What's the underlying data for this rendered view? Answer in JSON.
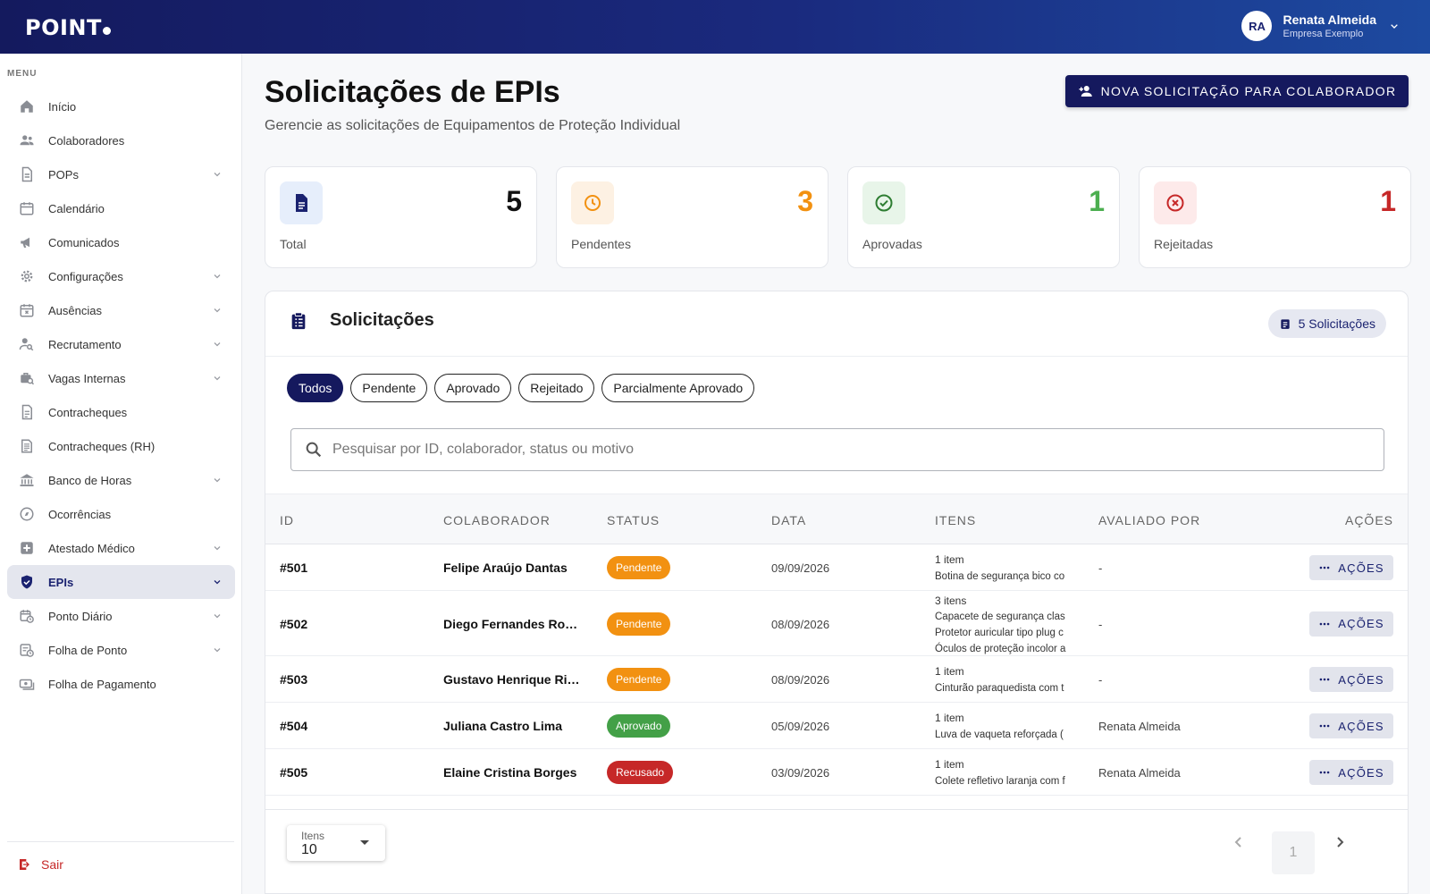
{
  "header": {
    "logo": "POINT",
    "user": {
      "initials": "RA",
      "name": "Renata Almeida",
      "company": "Empresa Exemplo"
    }
  },
  "sidebar": {
    "menu_label": "MENU",
    "items": [
      {
        "label": "Início",
        "icon": "home-icon",
        "has_submenu": false
      },
      {
        "label": "Colaboradores",
        "icon": "people-icon",
        "has_submenu": false
      },
      {
        "label": "POPs",
        "icon": "document-icon",
        "has_submenu": true
      },
      {
        "label": "Calendário",
        "icon": "calendar-icon",
        "has_submenu": false
      },
      {
        "label": "Comunicados",
        "icon": "megaphone-icon",
        "has_submenu": false
      },
      {
        "label": "Configurações",
        "icon": "gear-icon",
        "has_submenu": true
      },
      {
        "label": "Ausências",
        "icon": "calendar-x-icon",
        "has_submenu": true
      },
      {
        "label": "Recrutamento",
        "icon": "person-search-icon",
        "has_submenu": true
      },
      {
        "label": "Vagas Internas",
        "icon": "job-search-icon",
        "has_submenu": true
      },
      {
        "label": "Contracheques",
        "icon": "receipt-icon",
        "has_submenu": false
      },
      {
        "label": "Contracheques (RH)",
        "icon": "receipt-long-icon",
        "has_submenu": false
      },
      {
        "label": "Banco de Horas",
        "icon": "bank-icon",
        "has_submenu": true
      },
      {
        "label": "Ocorrências",
        "icon": "compass-icon",
        "has_submenu": false
      },
      {
        "label": "Atestado Médico",
        "icon": "medical-icon",
        "has_submenu": true
      },
      {
        "label": "EPIs",
        "icon": "shield-check-icon",
        "has_submenu": true,
        "active": true
      },
      {
        "label": "Ponto Diário",
        "icon": "calendar-clock-icon",
        "has_submenu": true
      },
      {
        "label": "Folha de Ponto",
        "icon": "timesheet-icon",
        "has_submenu": true
      },
      {
        "label": "Folha de Pagamento",
        "icon": "payments-icon",
        "has_submenu": false
      }
    ],
    "logout_label": "Sair"
  },
  "page": {
    "title": "Solicitações de EPIs",
    "subtitle": "Gerencie as solicitações de Equipamentos de Proteção Individual",
    "new_button_label": "NOVA SOLICITAÇÃO PARA COLABORADOR"
  },
  "stats": [
    {
      "label": "Total",
      "value": "5",
      "color": "#111111",
      "icon": "document-icon",
      "icon_bg": "#e6eefb",
      "icon_color": "#1a2270"
    },
    {
      "label": "Pendentes",
      "value": "3",
      "color": "#f29111",
      "icon": "clock-icon",
      "icon_bg": "#fdf1e3",
      "icon_color": "#f29111"
    },
    {
      "label": "Aprovadas",
      "value": "1",
      "color": "#4caf50",
      "icon": "check-circle-icon",
      "icon_bg": "#e8f5e9",
      "icon_color": "#2e7d32"
    },
    {
      "label": "Rejeitadas",
      "value": "1",
      "color": "#c62828",
      "icon": "cancel-circle-icon",
      "icon_bg": "#fdeaea",
      "icon_color": "#c62828"
    }
  ],
  "requests_panel": {
    "title": "Solicitações",
    "count_label": "5 Solicitações",
    "filters": [
      {
        "label": "Todos",
        "active": true
      },
      {
        "label": "Pendente",
        "active": false
      },
      {
        "label": "Aprovado",
        "active": false
      },
      {
        "label": "Rejeitado",
        "active": false
      },
      {
        "label": "Parcialmente Aprovado",
        "active": false
      }
    ],
    "search_placeholder": "Pesquisar por ID, colaborador, status ou motivo",
    "columns": [
      "ID",
      "COLABORADOR",
      "STATUS",
      "DATA",
      "ITENS",
      "AVALIADO POR",
      "AÇÕES"
    ],
    "rows": [
      {
        "id": "#501",
        "name": "Felipe Araújo Dantas",
        "status": "Pendente",
        "status_color": "#f29111",
        "date": "09/09/2026",
        "items_count": "1 item",
        "items": [
          "Botina de segurança bico co"
        ],
        "evaluator": "-",
        "action_label": "AÇÕES"
      },
      {
        "id": "#502",
        "name": "Diego Fernandes Rodrigues",
        "status": "Pendente",
        "status_color": "#f29111",
        "date": "08/09/2026",
        "items_count": "3 itens",
        "items": [
          "Capacete de segurança clas",
          "Protetor auricular tipo plug c",
          "Óculos de proteção incolor a"
        ],
        "evaluator": "-",
        "action_label": "AÇÕES"
      },
      {
        "id": "#503",
        "name": "Gustavo Henrique Ribeiro",
        "status": "Pendente",
        "status_color": "#f29111",
        "date": "08/09/2026",
        "items_count": "1 item",
        "items": [
          "Cinturão paraquedista com t"
        ],
        "evaluator": "-",
        "action_label": "AÇÕES"
      },
      {
        "id": "#504",
        "name": "Juliana Castro Lima",
        "status": "Aprovado",
        "status_color": "#43a047",
        "date": "05/09/2026",
        "items_count": "1 item",
        "items": [
          "Luva de vaqueta reforçada ("
        ],
        "evaluator": "Renata Almeida",
        "action_label": "AÇÕES"
      },
      {
        "id": "#505",
        "name": "Elaine Cristina Borges",
        "status": "Recusado",
        "status_color": "#c62828",
        "date": "03/09/2026",
        "items_count": "1 item",
        "items": [
          "Colete refletivo laranja com f"
        ],
        "evaluator": "Renata Almeida",
        "action_label": "AÇÕES"
      }
    ],
    "pagination": {
      "per_page_label": "Itens",
      "per_page_value": "10",
      "current_page": "1"
    }
  }
}
